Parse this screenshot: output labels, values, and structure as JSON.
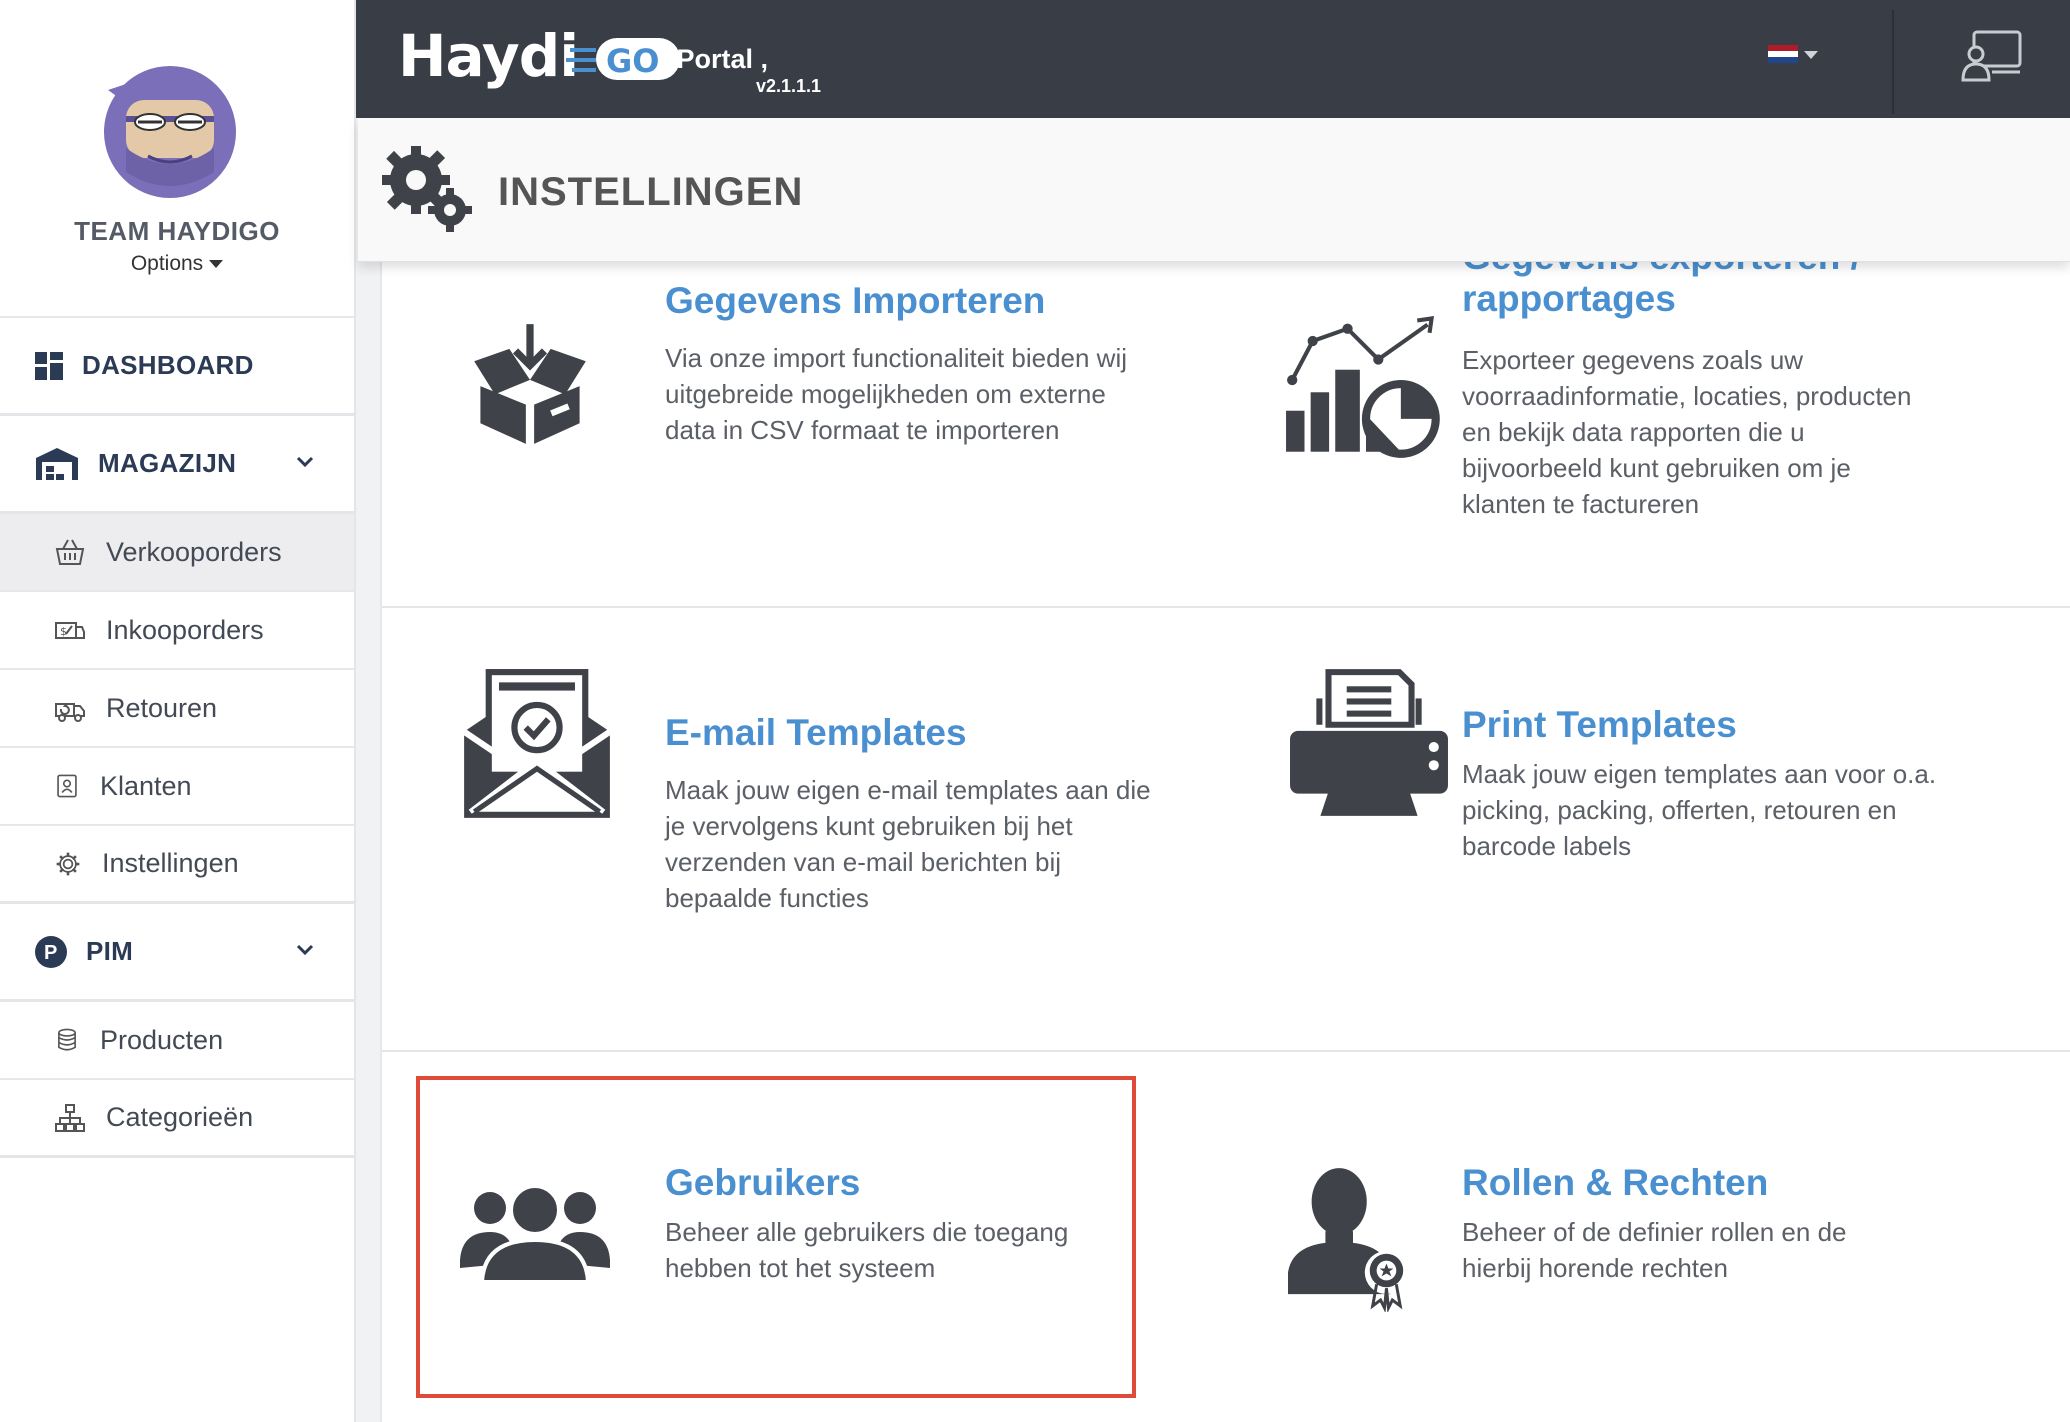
{
  "sidebar": {
    "team_name": "TEAM HAYDIGO",
    "options_label": "Options",
    "dashboard_label": "DASHBOARD",
    "magazijn_label": "MAGAZIJN",
    "magazijn_items": [
      "Verkooporders",
      "Inkooporders",
      "Retouren",
      "Klanten",
      "Instellingen"
    ],
    "pim_label": "PIM",
    "pim_items": [
      "Producten",
      "Categorieën"
    ]
  },
  "topbar": {
    "logo_text": "Haydi",
    "logo_go": "GO",
    "portal_label": "- Portal ,",
    "version": "v2.1.1.1"
  },
  "page": {
    "title": "INSTELLINGEN"
  },
  "tiles": {
    "import": {
      "title": "Gegevens Importeren",
      "desc": "Via onze import functionaliteit bieden wij uitgebreide mogelijkheden om externe data in CSV formaat te importeren"
    },
    "export": {
      "title_line1": "Gegevens exporteren /",
      "title_line2": "rapportages",
      "desc": "Exporteer gegevens zoals uw voorraadinformatie, locaties, producten en bekijk data rapporten die u bijvoorbeeld kunt gebruiken om je klanten te factureren"
    },
    "email": {
      "title": "E-mail Templates",
      "desc": "Maak jouw eigen e-mail templates aan die je vervolgens kunt gebruiken bij het verzenden van e-mail berichten bij bepaalde functies"
    },
    "print": {
      "title": "Print Templates",
      "desc": "Maak jouw eigen templates aan voor o.a. picking, packing, offerten, retouren en barcode labels"
    },
    "users": {
      "title": "Gebruikers",
      "desc": "Beheer alle gebruikers die toegang hebben tot het systeem"
    },
    "roles": {
      "title": "Rollen & Rechten",
      "desc": "Beheer of de definier rollen en de hierbij horende rechten"
    }
  },
  "colors": {
    "accent": "#4a90d0",
    "topbar": "#393d45",
    "highlight": "#e04a38",
    "nav_text": "#2b3a55"
  }
}
